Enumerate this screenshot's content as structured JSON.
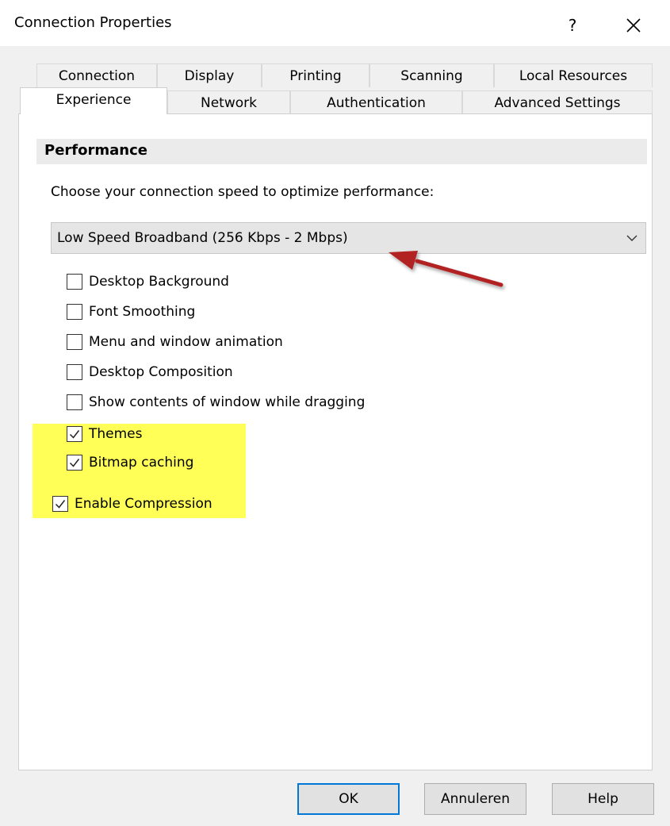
{
  "window": {
    "title": "Connection Properties",
    "help_label": "?"
  },
  "tabs": {
    "row1": [
      "Connection",
      "Display",
      "Printing",
      "Scanning",
      "Local Resources"
    ],
    "row2": [
      "Experience",
      "Network",
      "Authentication",
      "Advanced Settings"
    ],
    "active": "Experience"
  },
  "performance": {
    "section_title": "Performance",
    "instruction": "Choose your connection speed to optimize performance:",
    "speed_selected": "Low Speed Broadband (256 Kbps - 2 Mbps)",
    "options": [
      {
        "label": "Desktop Background",
        "checked": false
      },
      {
        "label": "Font Smoothing",
        "checked": false
      },
      {
        "label": "Menu and window animation",
        "checked": false
      },
      {
        "label": "Desktop Composition",
        "checked": false
      },
      {
        "label": "Show contents of window while dragging",
        "checked": false
      },
      {
        "label": "Themes",
        "checked": true
      },
      {
        "label": "Bitmap caching",
        "checked": true
      }
    ],
    "compression": {
      "label": "Enable Compression",
      "checked": true
    }
  },
  "annotation": {
    "highlight_color": "#ffff57",
    "arrow_color": "#b22222"
  },
  "buttons": {
    "ok": "OK",
    "cancel": "Annuleren",
    "help": "Help"
  }
}
